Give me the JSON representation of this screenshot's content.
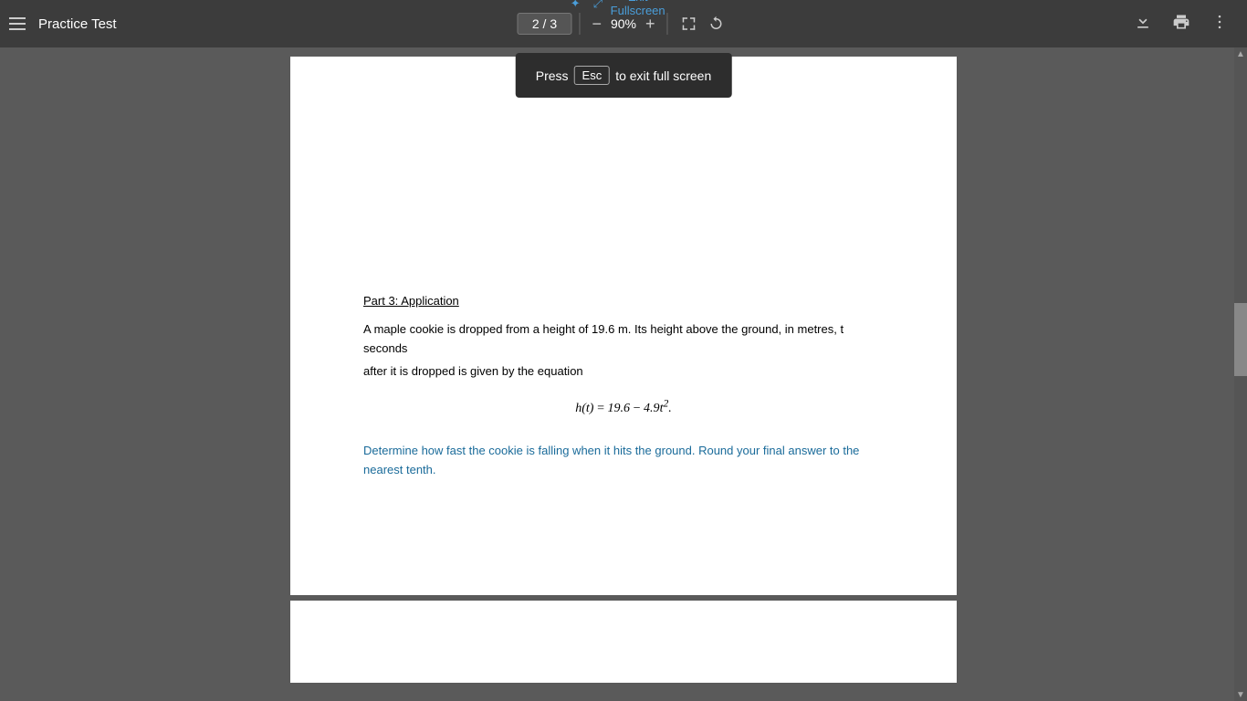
{
  "toolbar": {
    "menu_icon": "hamburger-menu",
    "title": "Practice Test",
    "pagination": {
      "current": "2",
      "separator": "/",
      "total": "3"
    },
    "zoom_out_label": "−",
    "zoom_level": "90%",
    "zoom_in_label": "+",
    "fit_page_icon": "fit-page-icon",
    "rotate_icon": "rotate-icon",
    "download_icon": "download-icon",
    "print_icon": "print-icon",
    "more_icon": "more-options-icon"
  },
  "exit_fullscreen": {
    "label": "Exit Fullscreen",
    "icon": "exit-fullscreen-icon"
  },
  "esc_tooltip": {
    "press_text": "Press",
    "esc_key": "Esc",
    "suffix_text": "to exit full screen"
  },
  "page2": {
    "section_title": "Part 3: Application",
    "question_body_1": "A maple cookie is dropped from a height of 19.6 m. Its height above the ground, in metres, t seconds",
    "question_body_2": "after it is dropped is given by the equation",
    "formula": "h(t) = 19.6 − 4.9t².",
    "instruction": "Determine how fast the cookie is falling when it hits the ground. Round your final answer to the nearest tenth."
  },
  "colors": {
    "toolbar_bg": "#3c3c3c",
    "page_bg": "#ffffff",
    "bg": "#5a5a5a",
    "instruction_color": "#1a6b9a",
    "exit_fs_color": "#4a9eda",
    "text_dark": "#000000"
  }
}
